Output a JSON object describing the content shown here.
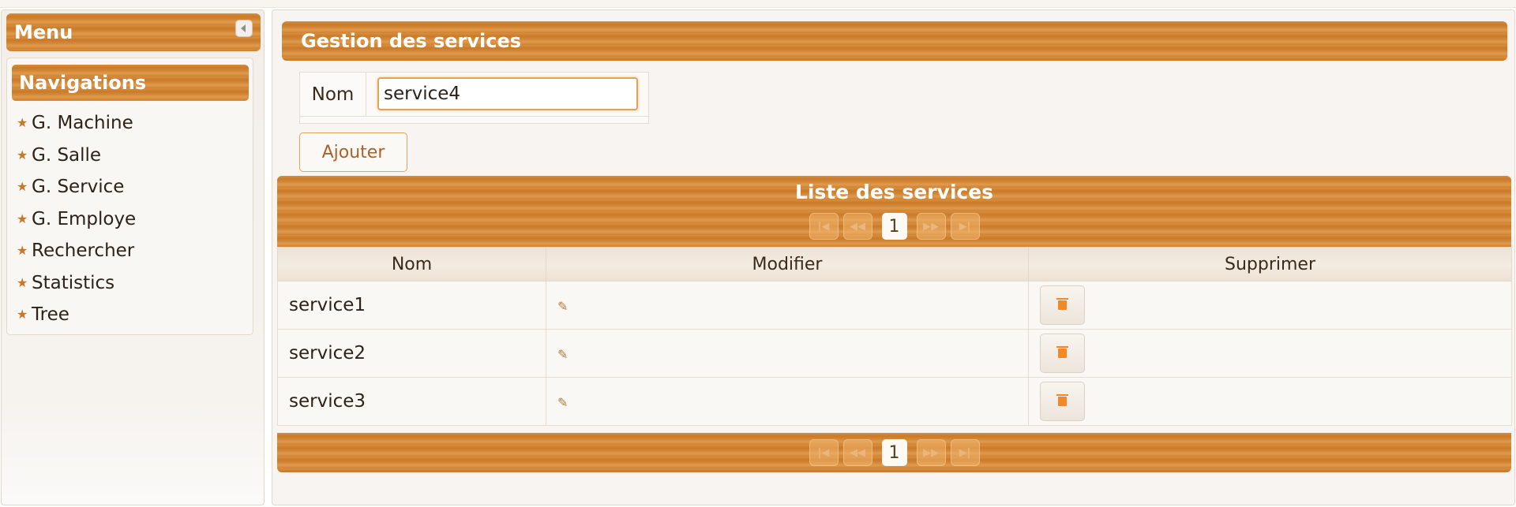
{
  "sidebar": {
    "menu_title": "Menu",
    "nav_title": "Navigations",
    "items": [
      {
        "label": "G. Machine"
      },
      {
        "label": "G. Salle"
      },
      {
        "label": "G. Service"
      },
      {
        "label": "G. Employe"
      },
      {
        "label": "Rechercher"
      },
      {
        "label": "Statistics"
      },
      {
        "label": "Tree"
      }
    ]
  },
  "gestion": {
    "title": "Gestion des services",
    "nom_label": "Nom",
    "nom_value": "service4",
    "add_label": "Ajouter"
  },
  "list": {
    "title": "Liste des services",
    "current_page": "1",
    "columns": [
      "Nom",
      "Modifier",
      "Supprimer"
    ],
    "rows": [
      {
        "nom": "service1"
      },
      {
        "nom": "service2"
      },
      {
        "nom": "service3"
      }
    ]
  },
  "colors": {
    "accent": "#cf8233",
    "delete_icon": "#f08a28"
  }
}
